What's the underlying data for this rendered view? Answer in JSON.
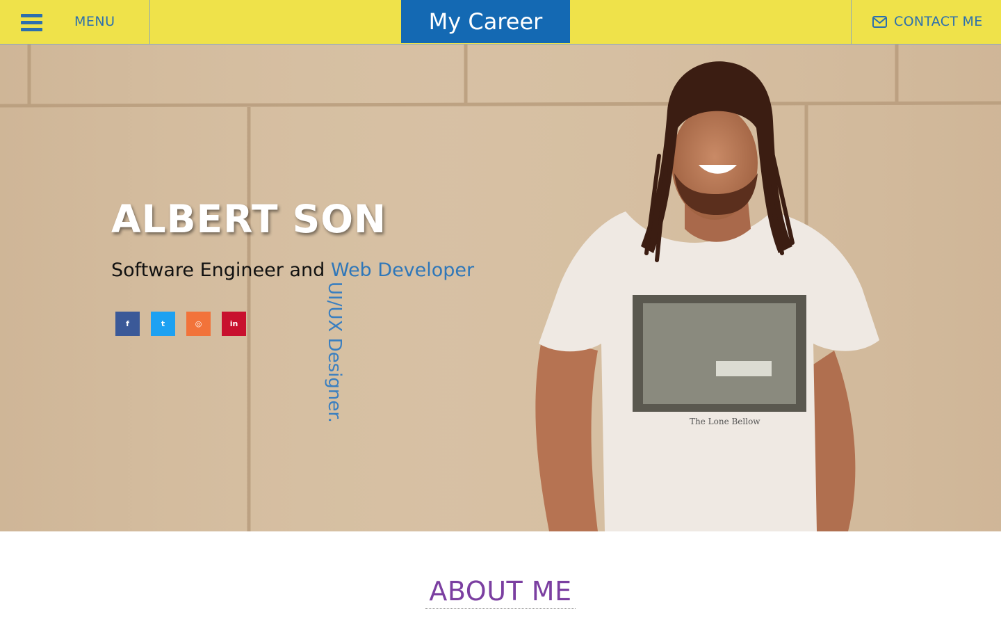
{
  "header": {
    "menu_label": "MENU",
    "brand": "My Career",
    "contact_label": "CONTACT ME",
    "background_color": "#efe24a",
    "brand_color": "#1469b3"
  },
  "hero": {
    "name": "ALBERT SON",
    "subtitle_prefix": "Software Engineer and",
    "subtitle_accent": "Web Developer",
    "rotated_role": "UI/UX Designer.",
    "photo_caption": "The Lone Bellow",
    "socials": [
      {
        "label": "f",
        "icon": "facebook-icon",
        "color": "#3b5998"
      },
      {
        "label": "t",
        "icon": "twitter-icon",
        "color": "#1da1f2"
      },
      {
        "label": "◎",
        "icon": "instagram-icon",
        "color": "#f2733a"
      },
      {
        "label": "in",
        "icon": "linkedin-icon",
        "color": "#c8102e"
      }
    ]
  },
  "about": {
    "title": "ABOUT ME",
    "title_color": "#7b3fa1"
  }
}
